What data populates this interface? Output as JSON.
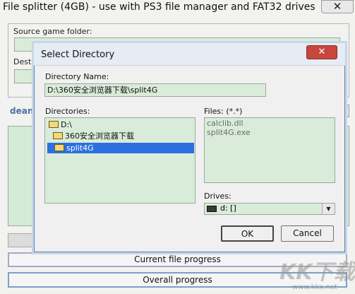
{
  "main": {
    "title": "File splitter (4GB) - use with PS3 file manager and FAT32 drives",
    "close_glyph": "✕",
    "source_label": "Source game folder:",
    "dest_label": "Destin",
    "deank": "deank",
    "current_progress": "Current file progress",
    "overall_progress": "Overall progress"
  },
  "dialog": {
    "title": "Select Directory",
    "close_glyph": "✕",
    "dir_name_label": "Directory Name:",
    "dir_name_value": "D:\\360安全浏览器下载\\split4G",
    "directories_label": "Directories:",
    "directories": [
      "D:\\",
      "360安全浏览器下载",
      "split4G"
    ],
    "files_label": "Files: (*.*)",
    "files": [
      "calclib.dll",
      "split4G.exe"
    ],
    "drives_label": "Drives:",
    "drive_value": "d: []",
    "drive_arrow": "▼",
    "ok_label": "OK",
    "cancel_label": "Cancel"
  },
  "watermark": {
    "text": "KK下载",
    "url": "www.kkx.net"
  }
}
